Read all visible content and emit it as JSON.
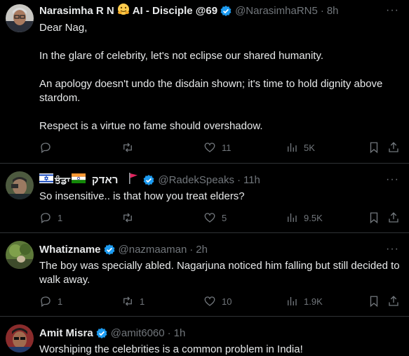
{
  "tweets": [
    {
      "name": "Narasimha R N",
      "name_suffix": "AI - Disciple @69",
      "handle": "@NarasimhaRN5",
      "time": "8h",
      "paragraphs": [
        "Dear Nag,",
        "In the glare of celebrity, let's not eclipse our shared humanity.",
        "An apology doesn't undo the disdain shown; it's time to hold dignity above stardom.",
        "Respect is a virtue no fame should overshadow."
      ],
      "replies": "",
      "reposts": "",
      "likes": "11",
      "views": "5K"
    },
    {
      "name": "ਝੰਡਾ",
      "name_suffix": "ראדק",
      "handle": "@RadekSpeaks",
      "time": "11h",
      "paragraphs": [
        "So insensitive.. is that how you treat elders?"
      ],
      "replies": "1",
      "reposts": "",
      "likes": "5",
      "views": "9.5K"
    },
    {
      "name": "Whatizname",
      "handle": "@nazmaaman",
      "time": "2h",
      "paragraphs": [
        "The boy was specially abled. Nagarjuna noticed him falling but still decided to walk away."
      ],
      "replies": "1",
      "reposts": "1",
      "likes": "10",
      "views": "1.9K"
    },
    {
      "name": "Amit Misra",
      "handle": "@amit6060",
      "time": "1h",
      "paragraphs": [
        "Worshiping the celebrities is a common problem in India!"
      ]
    }
  ],
  "more_label": "···",
  "dot": "·",
  "colors": {
    "background": "#000000",
    "text": "#e7e9ea",
    "muted": "#71767b",
    "verified": "#1d9bf0",
    "divider": "#2f3336"
  },
  "icons": [
    "verified-badge-icon",
    "hugging-face-emoji-icon",
    "israel-flag-icon",
    "india-flag-icon",
    "red-flag-icon",
    "reply-icon",
    "repost-icon",
    "like-icon",
    "views-icon",
    "bookmark-icon",
    "share-icon",
    "more-icon"
  ]
}
